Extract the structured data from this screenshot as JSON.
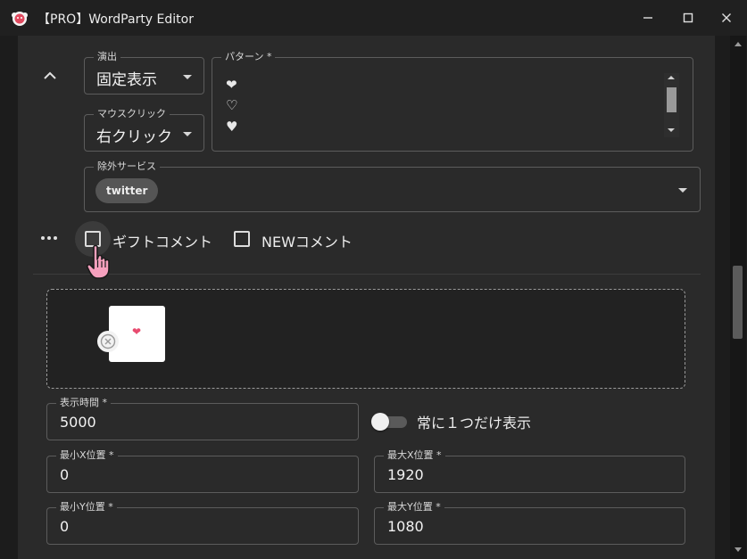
{
  "window": {
    "title": "【PRO】WordParty Editor",
    "minimize": "minimize",
    "maximize": "maximize",
    "close": "close"
  },
  "effect": {
    "label": "演出",
    "value": "固定表示"
  },
  "mouse_click": {
    "label": "マウスクリック",
    "value": "右クリック"
  },
  "pattern": {
    "label": "パターン *",
    "lines": [
      "❤",
      "♡",
      "♥"
    ]
  },
  "excluded_services": {
    "label": "除外サービス",
    "chips": [
      "twitter"
    ]
  },
  "options": {
    "gift_comment": {
      "label": "ギフトコメント",
      "checked": false
    },
    "new_comment": {
      "label": "NEWコメント",
      "checked": false
    }
  },
  "image": {
    "preview_symbol": "❤"
  },
  "display_time": {
    "label": "表示時間 *",
    "value": "5000"
  },
  "show_only_one": {
    "label": "常に１つだけ表示",
    "on": false
  },
  "min_x": {
    "label": "最小X位置 *",
    "value": "0"
  },
  "max_x": {
    "label": "最大X位置 *",
    "value": "1920"
  },
  "min_y": {
    "label": "最小Y位置 *",
    "value": "0"
  },
  "max_y": {
    "label": "最大Y位置 *",
    "value": "1080"
  },
  "colors": {
    "background": "#1c1c1c",
    "panel": "#2a2a2a",
    "heart_pink": "#e84a6f",
    "cursor_pink": "#f5a0bd"
  }
}
